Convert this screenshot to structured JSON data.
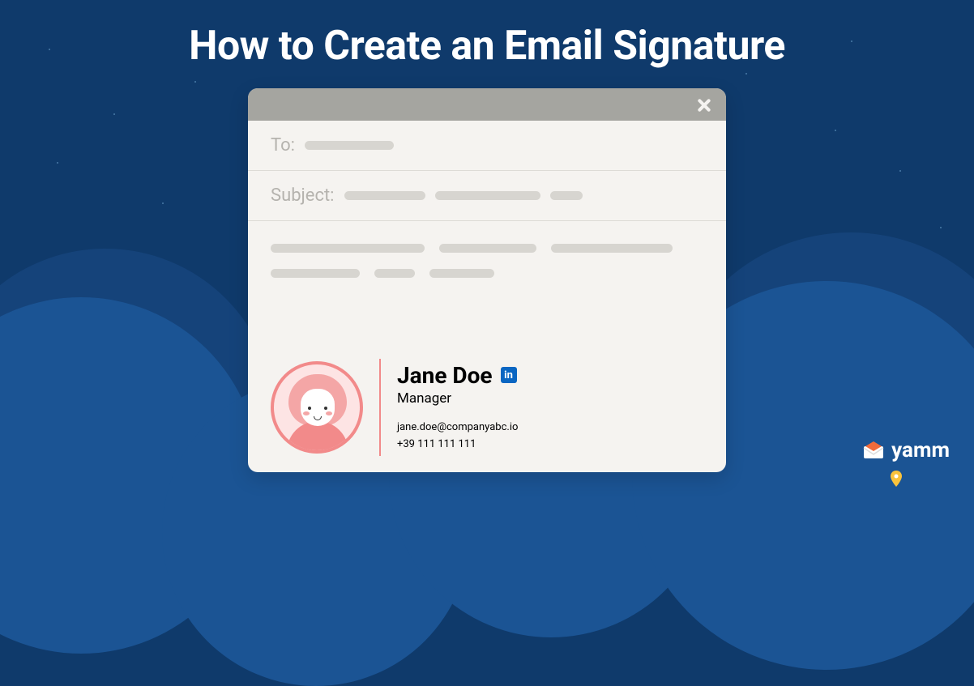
{
  "title": "How to Create an Email Signature",
  "email": {
    "to_label": "To:",
    "subject_label": "Subject:"
  },
  "signature": {
    "name": "Jane Doe",
    "role": "Manager",
    "email": "jane.doe@companyabc.io",
    "phone": "+39 111 111 111"
  },
  "brand": {
    "name": "yamm"
  }
}
